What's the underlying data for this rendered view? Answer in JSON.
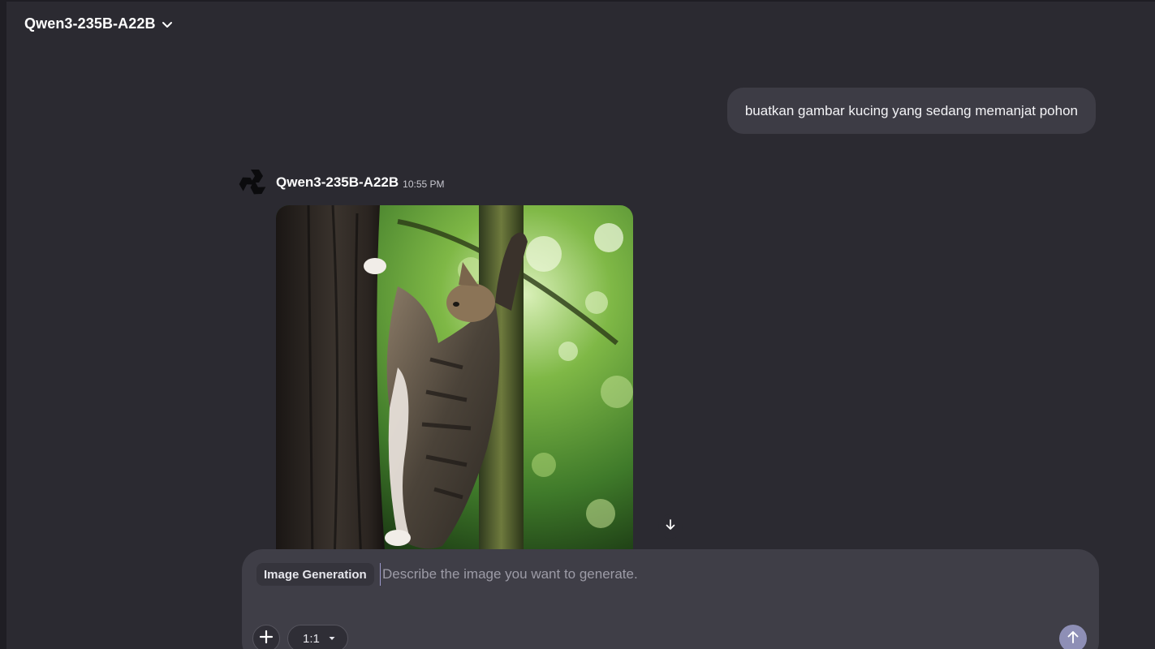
{
  "header": {
    "model_name": "Qwen3-235B-A22B",
    "dropdown_icon": "chevron-down-icon"
  },
  "conversation": {
    "user_message": "buatkan gambar kucing yang sedang memanjat pohon",
    "assistant": {
      "name": "Qwen3-235B-A22B",
      "time": "10:55 PM",
      "avatar_icon": "qwen-logo-icon"
    },
    "image_content": "cat-climbing-tree"
  },
  "composer": {
    "mode_label": "Image Generation",
    "placeholder": "Describe the image you want to generate.",
    "value": "",
    "aspect_ratio": "1:1",
    "add_icon": "plus-icon",
    "send_icon": "arrow-up-icon",
    "scroll_icon": "arrow-down-icon"
  },
  "colors": {
    "background": "#2b2a31",
    "bubble": "#3d3c45",
    "composer": "#3f3e47",
    "send_accent": "#8e8fb6"
  }
}
